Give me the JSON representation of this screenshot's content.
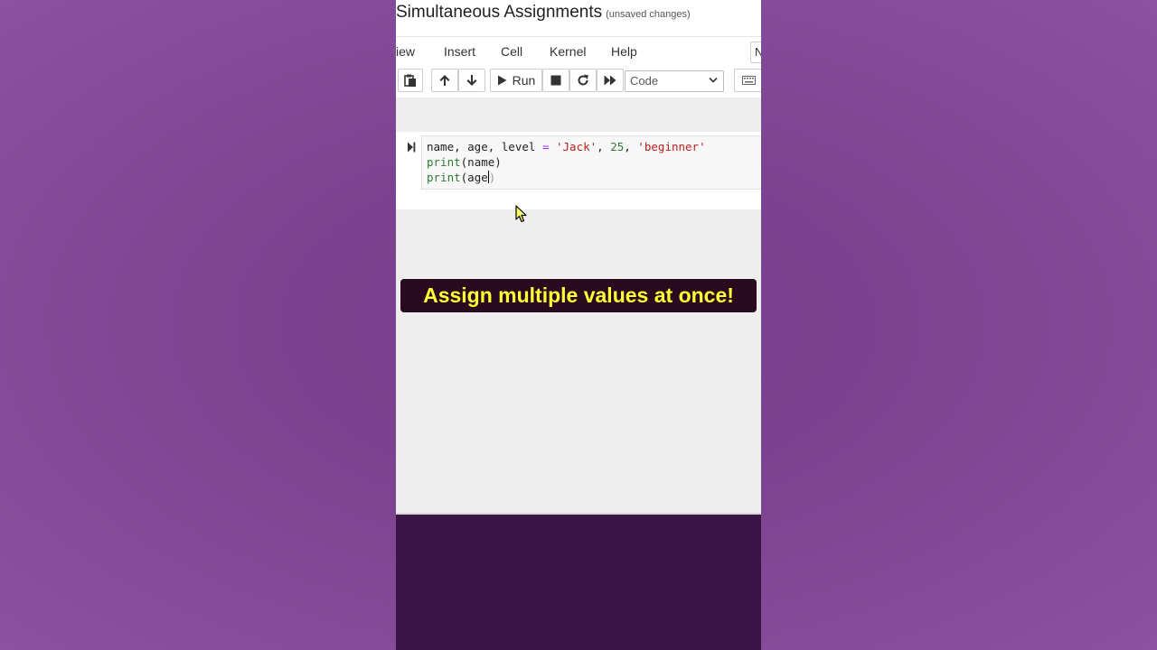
{
  "notebook": {
    "title": "Simultaneous Assignments",
    "save_status": "(unsaved changes)"
  },
  "menu": {
    "items": [
      "iew",
      "Insert",
      "Cell",
      "Kernel",
      "Help"
    ],
    "kbd_stub": "N"
  },
  "toolbar": {
    "run_label": "Run",
    "cell_type": "Code"
  },
  "cell": {
    "lines": [
      "name, age, level = 'Jack', 25, 'beginner'",
      "print(name)",
      "print(age)"
    ]
  },
  "caption": "Assign multiple values at once!"
}
